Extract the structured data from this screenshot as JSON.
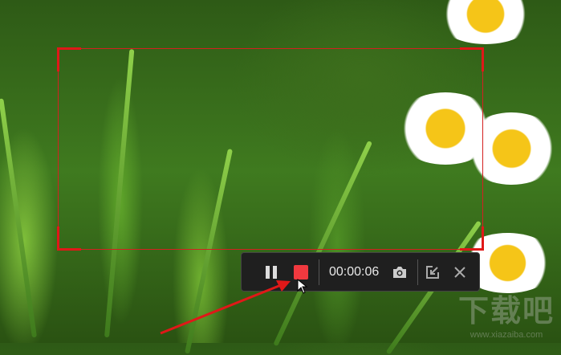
{
  "recorder": {
    "timer": "00:00:06",
    "buttons": {
      "pause": "Pause",
      "stop": "Stop",
      "screenshot": "Screenshot",
      "minimize": "Minimize",
      "close": "Close"
    }
  },
  "watermark": {
    "logo": "下载吧",
    "url": "www.xiazaiba.com"
  },
  "colors": {
    "selection": "#d42020",
    "stop": "#f0393f",
    "toolbar": "#1f1f1f"
  }
}
